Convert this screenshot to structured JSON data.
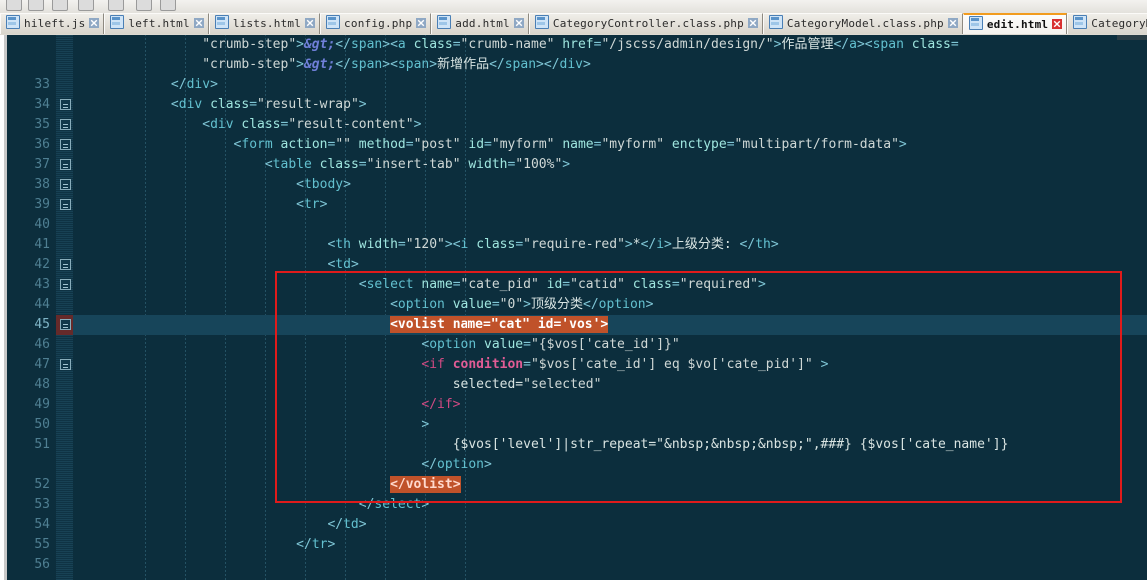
{
  "window": {
    "app": "code-editor",
    "active_file": "edit.html"
  },
  "tabs": [
    {
      "label": "hileft.js",
      "active": false,
      "icon": "file-icon",
      "close": "close-icon"
    },
    {
      "label": "left.html",
      "active": false,
      "icon": "file-icon",
      "close": "close-icon"
    },
    {
      "label": "lists.html",
      "active": false,
      "icon": "file-icon",
      "close": "close-icon"
    },
    {
      "label": "config.php",
      "active": false,
      "icon": "file-icon",
      "close": "close-icon"
    },
    {
      "label": "add.html",
      "active": false,
      "icon": "file-icon",
      "close": "close-icon"
    },
    {
      "label": "CategoryController.class.php",
      "active": false,
      "icon": "file-icon",
      "close": "close-icon"
    },
    {
      "label": "CategoryModel.class.php",
      "active": false,
      "icon": "file-icon",
      "close": "close-icon"
    },
    {
      "label": "edit.html",
      "active": true,
      "icon": "file-icon",
      "close": "close-icon"
    },
    {
      "label": "CategoryModel.class.php",
      "active": false,
      "icon": "file-icon",
      "close": "close-icon"
    }
  ],
  "editor": {
    "highlighted_line": 45,
    "accent_orange": "#f29c1f",
    "annotation_color": "#e01b1b",
    "background": "#0c2e3d",
    "gutter_color": "#4f7f92",
    "lines": [
      {
        "num": "",
        "fold": false,
        "text": "                \"crumb-step\">&gt;</span><a class=\"crumb-name\" href=\"/jscss/admin/design/\">作品管理</a><span class="
      },
      {
        "num": "",
        "fold": false,
        "text": "                \"crumb-step\">&gt;</span><span>新增作品</span></div>"
      },
      {
        "num": "33",
        "fold": false,
        "text": "            </div>"
      },
      {
        "num": "34",
        "fold": true,
        "text": "            <div class=\"result-wrap\">"
      },
      {
        "num": "35",
        "fold": true,
        "text": "                <div class=\"result-content\">"
      },
      {
        "num": "36",
        "fold": true,
        "text": "                    <form action=\"\" method=\"post\" id=\"myform\" name=\"myform\" enctype=\"multipart/form-data\">"
      },
      {
        "num": "37",
        "fold": true,
        "text": "                        <table class=\"insert-tab\" width=\"100%\">"
      },
      {
        "num": "38",
        "fold": true,
        "text": "                            <tbody>"
      },
      {
        "num": "39",
        "fold": true,
        "text": "                            <tr>"
      },
      {
        "num": "40",
        "fold": false,
        "text": ""
      },
      {
        "num": "41",
        "fold": false,
        "text": "                                <th width=\"120\"><i class=\"require-red\">*</i>上级分类: </th>"
      },
      {
        "num": "42",
        "fold": true,
        "text": "                                <td>"
      },
      {
        "num": "43",
        "fold": true,
        "text": "                                    <select name=\"cate_pid\" id=\"catid\" class=\"required\">"
      },
      {
        "num": "44",
        "fold": false,
        "text": "                                        <option value=\"0\">顶级分类</option>"
      },
      {
        "num": "45",
        "fold": true,
        "text": "                                        <volist name=\"cat\" id='vos'>"
      },
      {
        "num": "46",
        "fold": false,
        "text": "                                            <option value=\"{$vos['cate_id']}\""
      },
      {
        "num": "47",
        "fold": true,
        "text": "                                            <if condition=\"$vos['cate_id'] eq $vo['cate_pid']\" >"
      },
      {
        "num": "48",
        "fold": false,
        "text": "                                                selected=\"selected\""
      },
      {
        "num": "49",
        "fold": false,
        "text": "                                            </if>"
      },
      {
        "num": "50",
        "fold": false,
        "text": "                                            >"
      },
      {
        "num": "51",
        "fold": false,
        "text": "                                                {$vos['level']|str_repeat=\"&nbsp;&nbsp;&nbsp;\",###} {$vos['cate_name']}"
      },
      {
        "num": "",
        "fold": false,
        "text": "                                            </option>"
      },
      {
        "num": "52",
        "fold": false,
        "text": "                                        </volist>"
      },
      {
        "num": "53",
        "fold": false,
        "text": "                                    </select>"
      },
      {
        "num": "54",
        "fold": false,
        "text": "                                </td>"
      },
      {
        "num": "55",
        "fold": false,
        "text": "                            </tr>"
      },
      {
        "num": "56",
        "fold": false,
        "text": ""
      }
    ],
    "highlighted_tokens": [
      "<volist",
      "name=\"cat\"",
      "id='vos'>",
      "</volist>"
    ],
    "annotation": {
      "shape": "rectangle",
      "color": "#e01b1b",
      "wraps_lines": "43-52"
    }
  }
}
